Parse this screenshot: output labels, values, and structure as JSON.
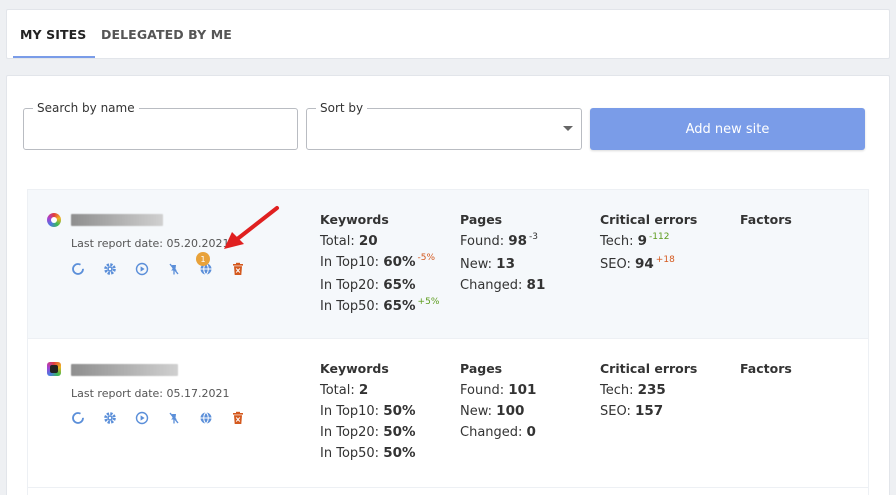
{
  "tabs": [
    {
      "label": "MY SITES"
    },
    {
      "label": "DELEGATED BY ME"
    }
  ],
  "search": {
    "label": "Search by name",
    "value": ""
  },
  "sort": {
    "label": "Sort by",
    "value": ""
  },
  "add_button": "Add new site",
  "colors": {
    "accent": "#7a9ce8",
    "badge": "#e8a23a",
    "negative": "#d4591e",
    "positive": "#5c9c1d",
    "arrow": "#e02020"
  },
  "sites": [
    {
      "report_date": "Last report date: 05.20.2021",
      "errors_badge": "1",
      "actions": [
        "refresh-icon",
        "settings-icon",
        "play-icon",
        "pin-icon",
        "globe-icon",
        "trash-icon"
      ],
      "keywords": {
        "title": "Keywords",
        "total_label": "Total:",
        "total": "20",
        "top10_label": "In Top10:",
        "top10": "60%",
        "top10_delta": "-5%",
        "top20_label": "In Top20:",
        "top20": "65%",
        "top50_label": "In Top50:",
        "top50": "65%",
        "top50_delta": "+5%"
      },
      "pages": {
        "title": "Pages",
        "found_label": "Found:",
        "found": "98",
        "found_delta": "-3",
        "new_label": "New:",
        "new": "13",
        "changed_label": "Changed:",
        "changed": "81"
      },
      "errors": {
        "title": "Critical errors",
        "tech_label": "Tech:",
        "tech": "9",
        "tech_delta": "-112",
        "seo_label": "SEO:",
        "seo": "94",
        "seo_delta": "+18"
      },
      "factors": {
        "title": "Factors"
      }
    },
    {
      "report_date": "Last report date: 05.17.2021",
      "actions": [
        "refresh-icon",
        "settings-icon",
        "play-icon",
        "pin-icon",
        "globe-icon",
        "trash-icon"
      ],
      "keywords": {
        "title": "Keywords",
        "total_label": "Total:",
        "total": "2",
        "top10_label": "In Top10:",
        "top10": "50%",
        "top20_label": "In Top20:",
        "top20": "50%",
        "top50_label": "In Top50:",
        "top50": "50%"
      },
      "pages": {
        "title": "Pages",
        "found_label": "Found:",
        "found": "101",
        "new_label": "New:",
        "new": "100",
        "changed_label": "Changed:",
        "changed": "0"
      },
      "errors": {
        "title": "Critical errors",
        "tech_label": "Tech:",
        "tech": "235",
        "seo_label": "SEO:",
        "seo": "157"
      },
      "factors": {
        "title": "Factors"
      }
    }
  ]
}
